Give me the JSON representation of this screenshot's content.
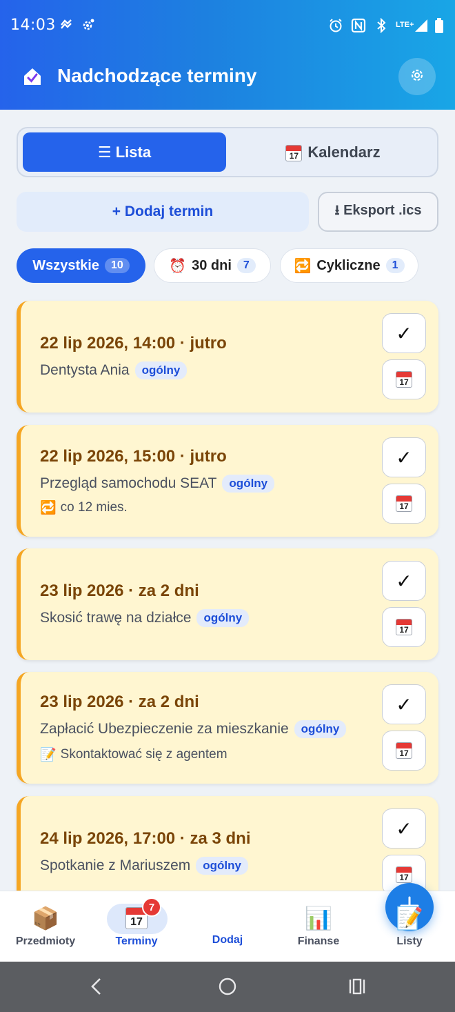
{
  "status_bar": {
    "time": "14:03",
    "icons": [
      "sync-icon",
      "settings-badge-icon",
      "alarm-icon",
      "nfc-icon",
      "bluetooth-icon",
      "lte-signal-icon",
      "battery-icon"
    ],
    "network": "LTE+"
  },
  "header": {
    "title": "Nadchodzące terminy",
    "home_icon": "home-check-icon",
    "settings_icon": "gear-icon"
  },
  "view_toggle": {
    "list_label": "☰ Lista",
    "calendar_label": "Kalendarz",
    "active": "list"
  },
  "actions": {
    "add_label": "+ Dodaj termin",
    "export_label": "⭳ Eksport .ics"
  },
  "filters": [
    {
      "label": "Wszystkie",
      "count": "10",
      "icon": "",
      "active": true
    },
    {
      "label": "30 dni",
      "count": "7",
      "icon": "⏰",
      "active": false
    },
    {
      "label": "Cykliczne",
      "count": "1",
      "icon": "🔁",
      "active": false
    }
  ],
  "events": [
    {
      "date": "22 lip 2026, 14:00 · jutro",
      "title": "Dentysta Ania",
      "tag": "ogólny",
      "extra_icon": "",
      "extra": ""
    },
    {
      "date": "22 lip 2026, 15:00 · jutro",
      "title": "Przegląd samochodu SEAT",
      "tag": "ogólny",
      "extra_icon": "🔁",
      "extra": "co 12 mies."
    },
    {
      "date": "23 lip 2026 · za 2 dni",
      "title": "Skosić trawę na działce",
      "tag": "ogólny",
      "extra_icon": "",
      "extra": ""
    },
    {
      "date": "23 lip 2026 · za 2 dni",
      "title": "Zapłacić Ubezpieczenie za mieszkanie",
      "tag": "ogólny",
      "extra_icon": "📝",
      "extra": "Skontaktować się z agentem"
    },
    {
      "date": "24 lip 2026, 17:00 · za 3 dni",
      "title": "Spotkanie z Mariuszem",
      "tag": "ogólny",
      "extra_icon": "",
      "extra": ""
    }
  ],
  "card_buttons": {
    "check_symbol": "✓",
    "calendar_day": "17",
    "calendar_month": "July"
  },
  "bottom_nav": {
    "items": [
      {
        "label": "Przedmioty",
        "icon": "📦"
      },
      {
        "label": "Terminy",
        "icon": "📅",
        "badge": "7",
        "active": true
      },
      {
        "label": "Dodaj",
        "icon": "plus-icon"
      },
      {
        "label": "Finanse",
        "icon": "📊"
      },
      {
        "label": "Listy",
        "icon": "📝"
      }
    ]
  },
  "colors": {
    "primary": "#2563eb",
    "card_bg": "#fff6d1",
    "card_accent": "#f5a623",
    "date_text": "#7a4508",
    "badge": "#e53935"
  }
}
